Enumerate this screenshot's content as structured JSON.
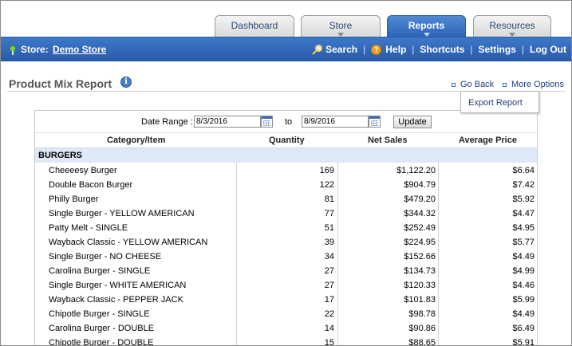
{
  "tabs": [
    {
      "label": "Dashboard",
      "active": false
    },
    {
      "label": "Store",
      "active": false
    },
    {
      "label": "Reports",
      "active": true
    },
    {
      "label": "Resources",
      "active": false
    }
  ],
  "navbar": {
    "store_label": "Store:",
    "store_name": "Demo Store",
    "links": {
      "search": "Search",
      "help": "Help",
      "shortcuts": "Shortcuts",
      "settings": "Settings",
      "logout": "Log Out"
    }
  },
  "page": {
    "title": "Product Mix Report",
    "go_back": "Go Back",
    "more_options": "More Options",
    "dropdown_item": "Export Report"
  },
  "filters": {
    "date_range_label": "Date Range :",
    "start_date": "8/3/2016",
    "to_label": "to",
    "end_date": "8/9/2016",
    "update_label": "Update"
  },
  "table": {
    "columns": [
      "Category/Item",
      "Quantity",
      "Net Sales",
      "Average Price"
    ],
    "category": "BURGERS",
    "rows": [
      {
        "item": "Cheeeesy Burger",
        "qty": "169",
        "sales": "$1,122.20",
        "avg": "$6.64"
      },
      {
        "item": "Double Bacon Burger",
        "qty": "122",
        "sales": "$904.79",
        "avg": "$7.42"
      },
      {
        "item": "Philly Burger",
        "qty": "81",
        "sales": "$479.20",
        "avg": "$5.92"
      },
      {
        "item": "Single Burger - YELLOW AMERICAN",
        "qty": "77",
        "sales": "$344.32",
        "avg": "$4.47"
      },
      {
        "item": "Patty Melt - SINGLE",
        "qty": "51",
        "sales": "$252.49",
        "avg": "$4.95"
      },
      {
        "item": "Wayback Classic - YELLOW AMERICAN",
        "qty": "39",
        "sales": "$224.95",
        "avg": "$5.77"
      },
      {
        "item": "Single Burger - NO CHEESE",
        "qty": "34",
        "sales": "$152.66",
        "avg": "$4.49"
      },
      {
        "item": "Carolina Burger - SINGLE",
        "qty": "27",
        "sales": "$134.73",
        "avg": "$4.99"
      },
      {
        "item": "Single Burger - WHITE AMERICAN",
        "qty": "27",
        "sales": "$120.33",
        "avg": "$4.46"
      },
      {
        "item": "Wayback Classic - PEPPER JACK",
        "qty": "17",
        "sales": "$101.83",
        "avg": "$5.99"
      },
      {
        "item": "Chipotle Burger - SINGLE",
        "qty": "22",
        "sales": "$98.78",
        "avg": "$4.49"
      },
      {
        "item": "Carolina Burger - DOUBLE",
        "qty": "14",
        "sales": "$90.86",
        "avg": "$6.49"
      },
      {
        "item": "Chipotle Burger - DOUBLE",
        "qty": "15",
        "sales": "$88.65",
        "avg": "$5.91"
      }
    ]
  },
  "colors": {
    "accent": "#2d63b8",
    "navbar": "#3f78c9",
    "category_bg": "#dde9f6"
  }
}
